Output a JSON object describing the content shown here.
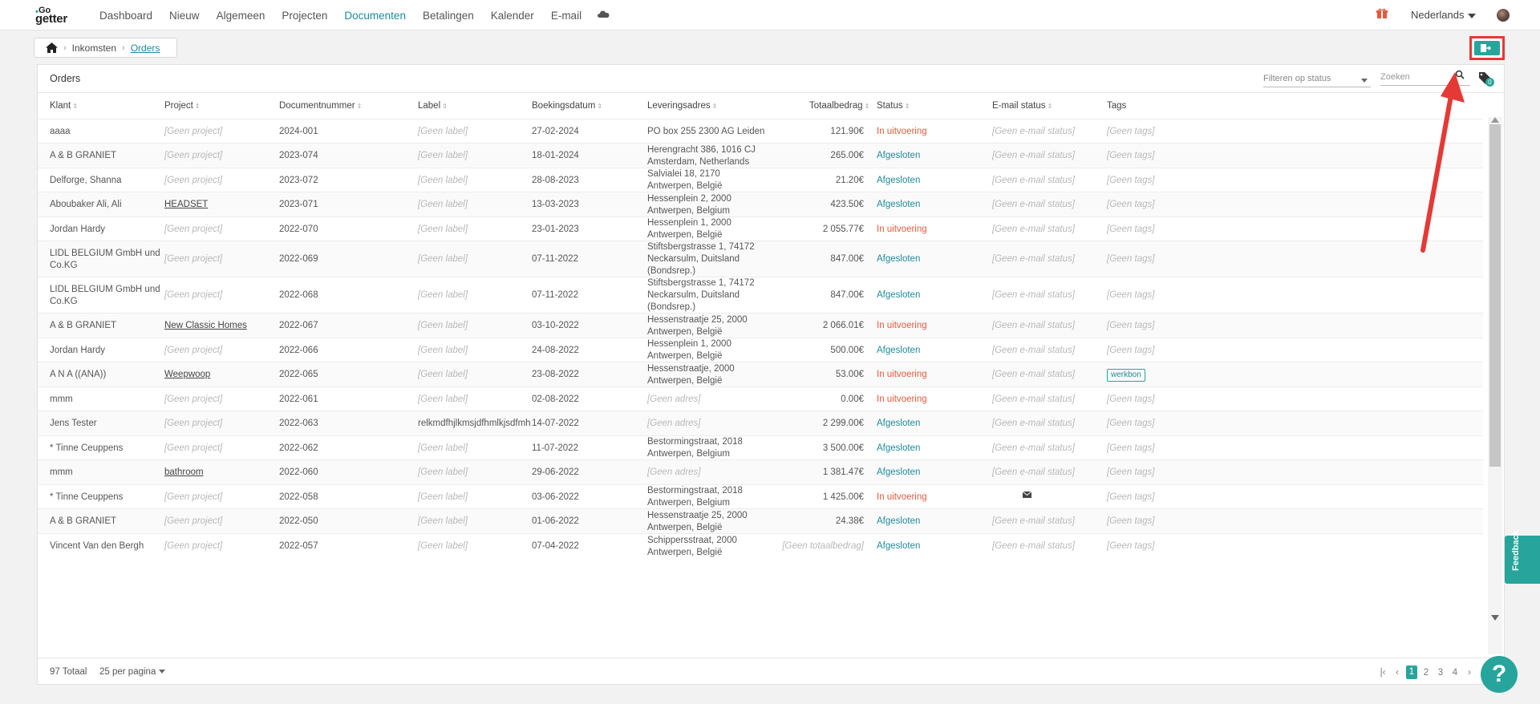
{
  "nav": {
    "items": [
      "Dashboard",
      "Nieuw",
      "Algemeen",
      "Projecten",
      "Documenten",
      "Betalingen",
      "Kalender",
      "E-mail"
    ],
    "active": "Documenten",
    "language": "Nederlands",
    "accent_color": "#27a59c"
  },
  "breadcrumb": {
    "parent": "Inkomsten",
    "current": "Orders"
  },
  "card": {
    "title": "Orders",
    "filter_placeholder": "Filteren op status",
    "search_placeholder": "Zoeken",
    "tag_count": "0"
  },
  "columns": [
    "Klant",
    "Project",
    "Documentnummer",
    "Label",
    "Boekingsdatum",
    "Leveringsadres",
    "Totaalbedrag",
    "Status",
    "E-mail status",
    "Tags"
  ],
  "rows": [
    {
      "klant": "aaaa",
      "project": "[Geen project]",
      "project_link": false,
      "nummer": "2024-001",
      "label": "[Geen label]",
      "datum": "27-02-2024",
      "adres": [
        "PO box 255 2300 AG Leiden"
      ],
      "bedrag": "121.90€",
      "status": "In uitvoering",
      "email": "[Geen e-mail status]",
      "tags": "[Geen tags]"
    },
    {
      "klant": "A & B GRANIET",
      "project": "[Geen project]",
      "project_link": false,
      "nummer": "2023-074",
      "label": "[Geen label]",
      "datum": "18-01-2024",
      "adres": [
        "Herengracht 386, 1016 CJ",
        "Amsterdam, Netherlands"
      ],
      "bedrag": "265.00€",
      "status": "Afgesloten",
      "email": "[Geen e-mail status]",
      "tags": "[Geen tags]"
    },
    {
      "klant": "Delforge, Shanna",
      "project": "[Geen project]",
      "project_link": false,
      "nummer": "2023-072",
      "label": "[Geen label]",
      "datum": "28-08-2023",
      "adres": [
        "Salvialei 18, 2170",
        "Antwerpen, België"
      ],
      "bedrag": "21.20€",
      "status": "Afgesloten",
      "email": "[Geen e-mail status]",
      "tags": "[Geen tags]"
    },
    {
      "klant": "Aboubaker Ali, Ali",
      "project": "HEADSET",
      "project_link": true,
      "nummer": "2023-071",
      "label": "[Geen label]",
      "datum": "13-03-2023",
      "adres": [
        "Hessenplein 2, 2000",
        "Antwerpen, Belgium"
      ],
      "bedrag": "423.50€",
      "status": "Afgesloten",
      "email": "[Geen e-mail status]",
      "tags": "[Geen tags]"
    },
    {
      "klant": "Jordan Hardy",
      "project": "[Geen project]",
      "project_link": false,
      "nummer": "2022-070",
      "label": "[Geen label]",
      "datum": "23-01-2023",
      "adres": [
        "Hessenplein 1, 2000",
        "Antwerpen, België"
      ],
      "bedrag": "2 055.77€",
      "status": "In uitvoering",
      "email": "[Geen e-mail status]",
      "tags": "[Geen tags]"
    },
    {
      "klant": "LIDL BELGIUM GmbH und Co.KG",
      "klant_lines": [
        "LIDL BELGIUM GmbH und",
        "Co.KG"
      ],
      "project": "[Geen project]",
      "project_link": false,
      "nummer": "2022-069",
      "label": "[Geen label]",
      "datum": "07-11-2022",
      "adres": [
        "Stiftsbergstrasse 1, 74172",
        "Neckarsulm, Duitsland",
        "(Bondsrep.)"
      ],
      "bedrag": "847.00€",
      "status": "Afgesloten",
      "email": "[Geen e-mail status]",
      "tags": "[Geen tags]"
    },
    {
      "klant": "LIDL BELGIUM GmbH und Co.KG",
      "klant_lines": [
        "LIDL BELGIUM GmbH und",
        "Co.KG"
      ],
      "project": "[Geen project]",
      "project_link": false,
      "nummer": "2022-068",
      "label": "[Geen label]",
      "datum": "07-11-2022",
      "adres": [
        "Stiftsbergstrasse 1, 74172",
        "Neckarsulm, Duitsland",
        "(Bondsrep.)"
      ],
      "bedrag": "847.00€",
      "status": "Afgesloten",
      "email": "[Geen e-mail status]",
      "tags": "[Geen tags]"
    },
    {
      "klant": "A & B GRANIET",
      "project": "New Classic Homes",
      "project_link": true,
      "nummer": "2022-067",
      "label": "[Geen label]",
      "datum": "03-10-2022",
      "adres": [
        "Hessenstraatje 25, 2000",
        "Antwerpen, België"
      ],
      "bedrag": "2 066.01€",
      "status": "In uitvoering",
      "email": "[Geen e-mail status]",
      "tags": "[Geen tags]"
    },
    {
      "klant": "Jordan Hardy",
      "project": "[Geen project]",
      "project_link": false,
      "nummer": "2022-066",
      "label": "[Geen label]",
      "datum": "24-08-2022",
      "adres": [
        "Hessenplein 1, 2000",
        "Antwerpen, België"
      ],
      "bedrag": "500.00€",
      "status": "Afgesloten",
      "email": "[Geen e-mail status]",
      "tags": "[Geen tags]"
    },
    {
      "klant": "A N A ((ANA))",
      "project": "Weepwoop",
      "project_link": true,
      "nummer": "2022-065",
      "label": "[Geen label]",
      "datum": "23-08-2022",
      "adres": [
        "Hessenstraatje, 2000",
        "Antwerpen, België"
      ],
      "bedrag": "53.00€",
      "status": "In uitvoering",
      "email": "[Geen e-mail status]",
      "tags": "werkbon",
      "tag_chip": true
    },
    {
      "klant": "mmm",
      "project": "[Geen project]",
      "project_link": false,
      "nummer": "2022-061",
      "label": "[Geen label]",
      "datum": "02-08-2022",
      "adres_muted": "[Geen adres]",
      "bedrag": "0.00€",
      "status": "In uitvoering",
      "email": "[Geen e-mail status]",
      "tags": "[Geen tags]"
    },
    {
      "klant": "Jens Tester",
      "project": "[Geen project]",
      "project_link": false,
      "nummer": "2022-063",
      "label_text": "relkmdfhjlkmsjdfhmlkjsdfmh",
      "datum": "14-07-2022",
      "adres_muted": "[Geen adres]",
      "bedrag": "2 299.00€",
      "status": "Afgesloten",
      "email": "[Geen e-mail status]",
      "tags": "[Geen tags]"
    },
    {
      "klant": "* Tinne Ceuppens",
      "project": "[Geen project]",
      "project_link": false,
      "nummer": "2022-062",
      "label": "[Geen label]",
      "datum": "11-07-2022",
      "adres": [
        "Bestormingstraat, 2018",
        "Antwerpen, Belgium"
      ],
      "bedrag": "3 500.00€",
      "status": "Afgesloten",
      "email": "[Geen e-mail status]",
      "tags": "[Geen tags]"
    },
    {
      "klant": "mmm",
      "project": "bathroom",
      "project_link": true,
      "nummer": "2022-060",
      "label": "[Geen label]",
      "datum": "29-06-2022",
      "adres_muted": "[Geen adres]",
      "bedrag": "1 381.47€",
      "status": "Afgesloten",
      "email": "[Geen e-mail status]",
      "tags": "[Geen tags]"
    },
    {
      "klant": "* Tinne Ceuppens",
      "project": "[Geen project]",
      "project_link": false,
      "nummer": "2022-058",
      "label": "[Geen label]",
      "datum": "03-06-2022",
      "adres": [
        "Bestormingstraat, 2018",
        "Antwerpen, Belgium"
      ],
      "bedrag": "1 425.00€",
      "status": "In uitvoering",
      "email_icon": "mail-icon",
      "tags": "[Geen tags]"
    },
    {
      "klant": "A & B GRANIET",
      "project": "[Geen project]",
      "project_link": false,
      "nummer": "2022-050",
      "label": "[Geen label]",
      "datum": "01-06-2022",
      "adres": [
        "Hessenstraatje 25, 2000",
        "Antwerpen, België"
      ],
      "bedrag": "24.38€",
      "status": "Afgesloten",
      "email": "[Geen e-mail status]",
      "tags": "[Geen tags]"
    },
    {
      "klant": "Vincent Van den Bergh",
      "project": "[Geen project]",
      "project_link": false,
      "nummer": "2022-057",
      "label": "[Geen label]",
      "datum": "07-04-2022",
      "adres": [
        "Schippersstraat, 2000",
        "Antwerpen, België"
      ],
      "bedrag_muted": "[Geen totaalbedrag]",
      "status": "Afgesloten",
      "email": "[Geen e-mail status]",
      "tags": "[Geen tags]"
    }
  ],
  "footer": {
    "total": "97 Totaal",
    "per_page": "25 per pagina",
    "pages": [
      "1",
      "2",
      "3",
      "4"
    ],
    "current_page": "1"
  },
  "feedback_label": "Feedback",
  "help_label": "?",
  "colors": {
    "status_open": "#e8593c",
    "status_done": "#1e8a9c",
    "annotation": "#e53935"
  }
}
